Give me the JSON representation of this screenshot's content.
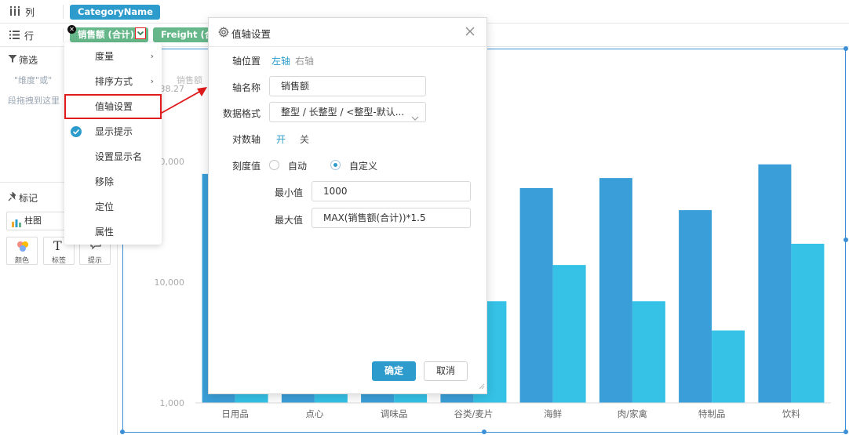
{
  "shelf": {
    "columns_label": "列",
    "rows_label": "行",
    "column_pill": "CategoryName",
    "row_pill_sales": "销售额 (合计)",
    "row_pill_freight": "Freight (合"
  },
  "left_panel": {
    "filter_title": "筛选",
    "filter_hint_1": "\"维度\"或\"",
    "filter_hint_2": "段拖拽到这里",
    "marks_title": "标记",
    "mark_type": "柱图",
    "buttons": [
      "颜色",
      "标签",
      "提示"
    ]
  },
  "context_menu": {
    "items": [
      "度量",
      "排序方式",
      "值轴设置",
      "显示提示",
      "设置显示名",
      "移除",
      "定位",
      "属性"
    ]
  },
  "dialog": {
    "title": "值轴设置",
    "axis_position_label": "轴位置",
    "axis_left": "左轴",
    "axis_right": "右轴",
    "axis_name_label": "轴名称",
    "axis_name_value": "销售额",
    "format_label": "数据格式",
    "format_value": "整型 / 长整型 / <整型-默认...",
    "log_label": "对数轴",
    "log_on": "开",
    "log_off": "关",
    "scale_label": "刻度值",
    "scale_auto": "自动",
    "scale_custom": "自定义",
    "min_label": "最小值",
    "min_value": "1000",
    "max_label": "最大值",
    "max_value": "MAX(销售额(合计))*1.5",
    "ok_button": "确定",
    "cancel_button": "取消"
  },
  "colors": {
    "accent": "#2d9ccd",
    "series_sales": "#3a9fd8",
    "series_freight": "#35c2e6",
    "highlight_border": "#e01b1b",
    "selection": "#3a8fd6"
  },
  "chart_data": {
    "type": "bar",
    "ylabel": "销售额",
    "y_scale": "log",
    "ylim": [
      1000,
      130000
    ],
    "y_ticks": [
      "1,000",
      "10,000",
      "0,000",
      "38.27"
    ],
    "categories": [
      "日用品",
      "点心",
      "调味品",
      "谷类/麦片",
      "海鲜",
      "肉/家禽",
      "特制品",
      "饮料"
    ],
    "series": [
      {
        "values": [
          80000,
          60000,
          55000,
          38000,
          61000,
          74000,
          40000,
          96000
        ]
      },
      {
        "values": [
          8000,
          15000,
          12000,
          7000,
          14000,
          7000,
          4000,
          21000
        ]
      }
    ]
  }
}
